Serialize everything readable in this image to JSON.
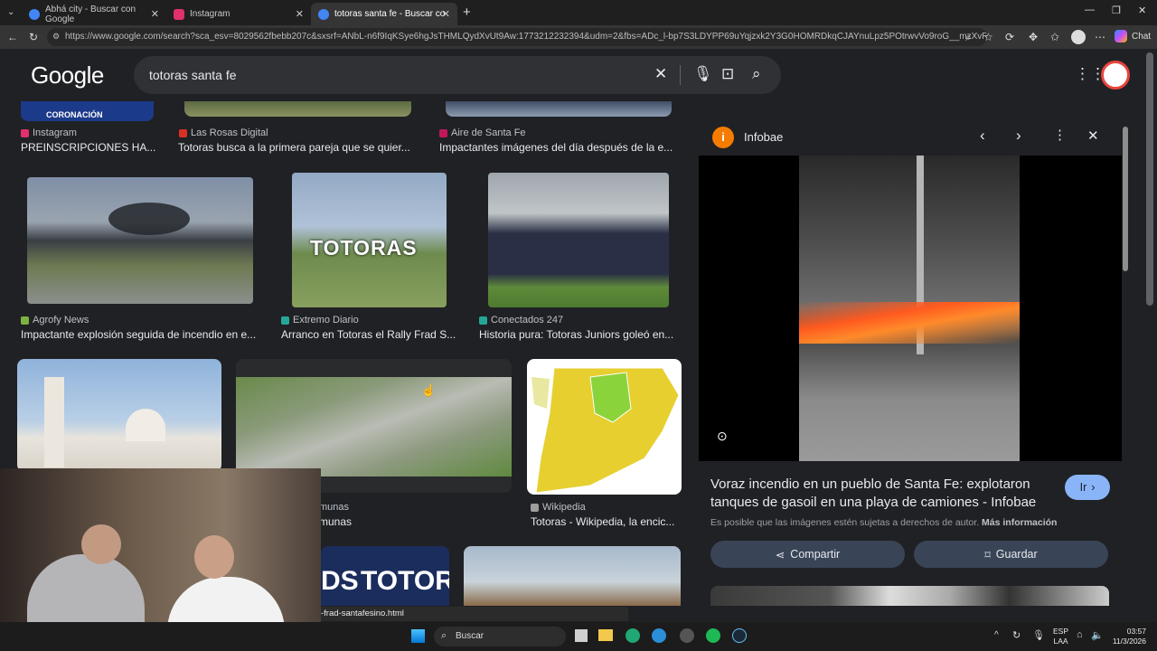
{
  "browser": {
    "tabs": [
      {
        "title": "Abhá city - Buscar con Google",
        "color": "#4285f4"
      },
      {
        "title": "Instagram",
        "color": "#e1306c"
      },
      {
        "title": "totoras santa fe - Buscar con Goo",
        "color": "#4285f4"
      }
    ],
    "url": "https://www.google.com/search?sca_esv=8029562fbebb207c&sxsrf=ANbL-n6f9IqKSye6hgJsTHMLQydXvUt9Aw:1773212232394&udm=2&fbs=ADc_l-bp7S3LDYPP69uYqjzxk2Y3G0HOMRDkqCJAYnuLpz5POtrwvVo9roG__mzXvRjBzB8AOmylH...",
    "url_host": "www.google.com",
    "chat_label": "Chat"
  },
  "google": {
    "logo": "Google",
    "query": "totoras santa fe"
  },
  "results": {
    "row0": [
      {
        "source": "Instagram",
        "title": "PREINSCRIPCIONES HA...",
        "fav": "#e1306c",
        "thumb_text": "CORONACIÓN"
      },
      {
        "source": "Las Rosas Digital",
        "title": "Totoras busca a la primera pareja que se quier...",
        "fav": "#d93025"
      },
      {
        "source": "Aire de Santa Fe",
        "title": "Impactantes imágenes del día después de la e...",
        "fav": "#c2185b"
      }
    ],
    "row1": [
      {
        "source": "Agrofy News",
        "title": "Impactante explosión seguida de incendio en e...",
        "fav": "#7cb342"
      },
      {
        "source": "Extremo Diario",
        "title": "Arranco en Totoras el Rally Frad S...",
        "fav": "#26a69a",
        "thumb_text": "TOTORAS"
      },
      {
        "source": "Conectados 247",
        "title": "Historia pura: Totoras Juniors goleó en...",
        "fav": "#26a69a"
      }
    ],
    "row2": [
      {
        "source": "Wikipedia",
        "title": "Totoras - Wikipedia, la encic...",
        "fav": "#9e9e9e"
      },
      {
        "source": "munas",
        "title": "munas"
      }
    ],
    "row3_banner": "TOTORA",
    "row3_banner_left": "DS"
  },
  "panel": {
    "source": "Infobae",
    "title": "Voraz incendio en un pueblo de Santa Fe: explotaron tanques de gasoil en una playa de camiones - Infobae",
    "go_label": "Ir",
    "rights_text": "Es posible que las imágenes estén sujetas a derechos de autor.",
    "more_info": "Más información",
    "share_label": "Compartir",
    "save_label": "Guardar"
  },
  "status_url": "-frad-santafesino.html",
  "taskbar": {
    "search_label": "Buscar",
    "lang_top": "ESP",
    "lang_bottom": "LAA",
    "time": "03:57",
    "date": "11/3/2026"
  }
}
